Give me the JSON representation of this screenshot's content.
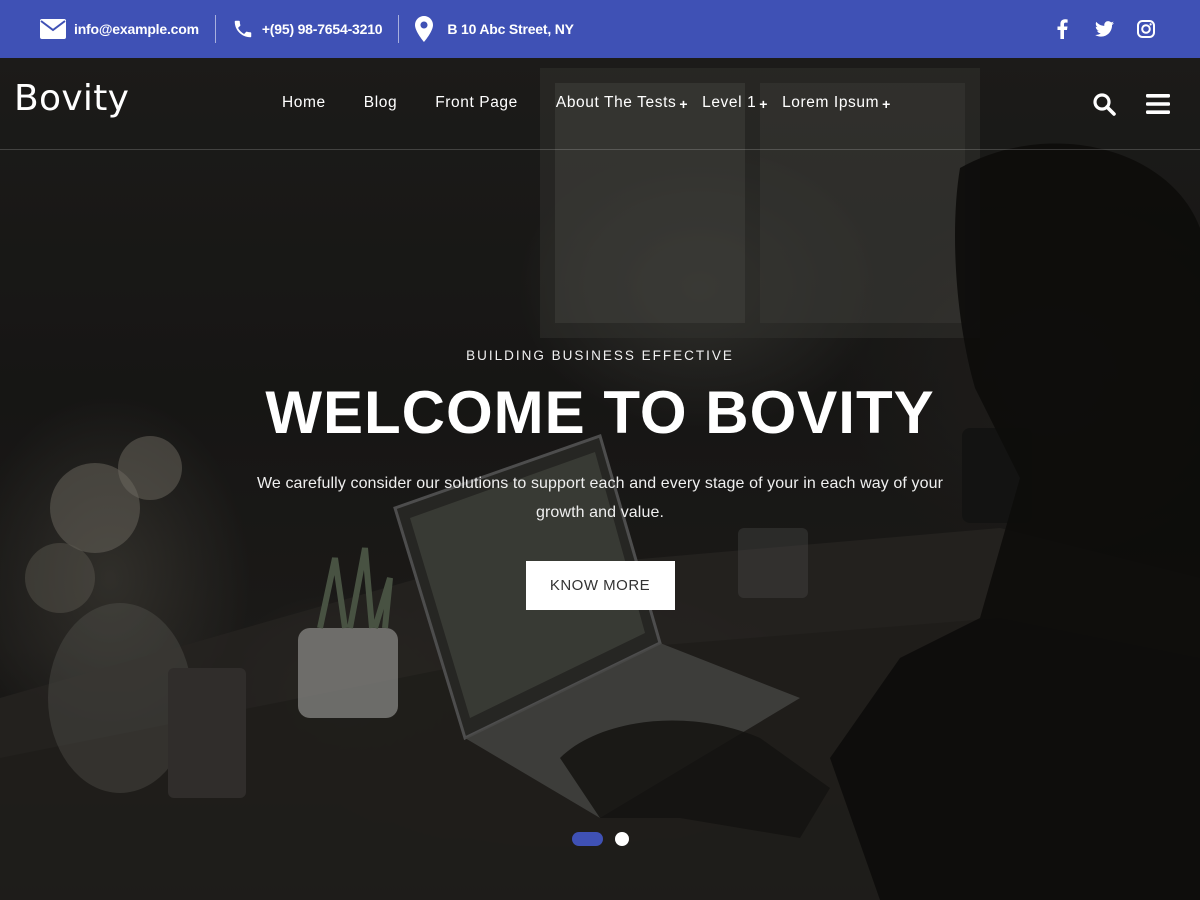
{
  "topbar": {
    "email": "info@example.com",
    "phone": "+(95) 98-7654-3210",
    "address": "B 10 Abc Street, NY",
    "icons": [
      "mail-icon",
      "phone-icon",
      "location-pin-icon"
    ],
    "socials": [
      "facebook-icon",
      "twitter-icon",
      "instagram-icon"
    ],
    "background_color": "#3f51b5"
  },
  "header": {
    "logo": "Bovity",
    "nav": [
      {
        "label": "Home",
        "has_submenu": false
      },
      {
        "label": "Blog",
        "has_submenu": false
      },
      {
        "label": "Front Page",
        "has_submenu": false
      },
      {
        "label": "About The Tests",
        "has_submenu": true
      },
      {
        "label": "Level 1",
        "has_submenu": true
      },
      {
        "label": "Lorem Ipsum",
        "has_submenu": true
      }
    ],
    "submenu_glyph": "+",
    "icons": [
      "search-icon",
      "hamburger-menu-icon"
    ]
  },
  "hero": {
    "eyebrow": "BUILDING BUSINESS EFFECTIVE",
    "title": "WELCOME TO BOVITY",
    "description": "We carefully consider our solutions to support each and every stage of your in each way of your growth and value.",
    "cta_label": "KNOW MORE",
    "slides": {
      "total": 2,
      "active": 1
    },
    "accent_color": "#3f51b5"
  }
}
